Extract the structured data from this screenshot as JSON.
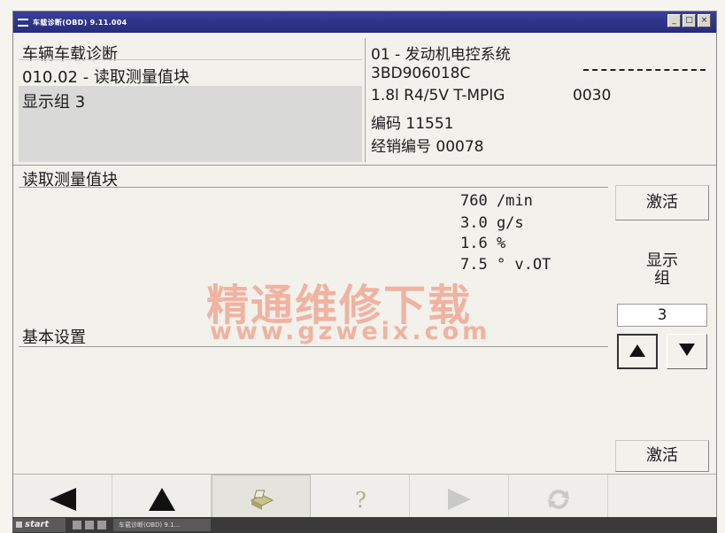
{
  "window": {
    "title": "车载诊断(OBD) 9.11.004",
    "buttons": [
      "_",
      "□",
      "×"
    ]
  },
  "header_left": {
    "line1": "车辆车载诊断",
    "line2": "010.02 - 读取测量值块",
    "selected": "显示组 3"
  },
  "header_right": {
    "system": "01 - 发动机电控系统",
    "part_number": "3BD906018C",
    "engine": "1.8l R4/5V T-MPIG",
    "engine_code": "0030",
    "coding": "编码 11551",
    "dealer": "经销编号 00078"
  },
  "section": {
    "title": "读取测量值块",
    "values": [
      "760 /min",
      "3.0 g/s",
      "1.6 %",
      "7.5 ° v.OT"
    ],
    "basic_settings_label": "基本设置"
  },
  "watermark": {
    "title": "精通维修下载",
    "url": "www.gzweix.com"
  },
  "controls": {
    "activate_top": "激活",
    "group_label": "显示组",
    "group_value": "3",
    "up_icon": "triangle-up",
    "down_icon": "triangle-down",
    "activate_bottom": "激活"
  },
  "toolbar": {
    "icons": [
      "back-arrow-icon",
      "up-arrow-icon",
      "print-icon",
      "help-icon",
      "forward-arrow-icon",
      "refresh-icon"
    ]
  },
  "taskbar": {
    "start_label": "start",
    "task_label": "车载诊断(OBD) 9.1..."
  }
}
